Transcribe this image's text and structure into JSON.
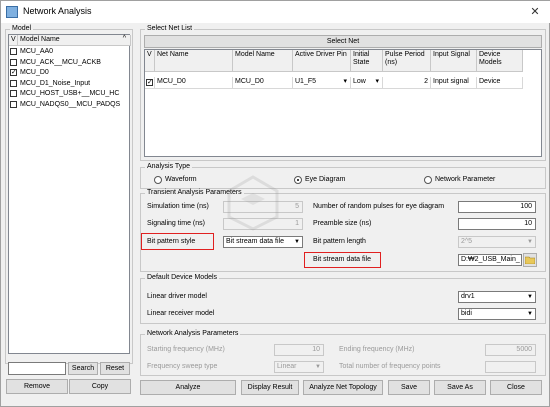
{
  "window": {
    "title": "Network Analysis",
    "close_glyph": "✕"
  },
  "model_panel": {
    "group_label": "Model",
    "header_v": "V",
    "header_name": "Model Name",
    "items": [
      {
        "checked": false,
        "name": "MCU_AA0"
      },
      {
        "checked": false,
        "name": "MCU_ACK__MCU_ACKB"
      },
      {
        "checked": true,
        "name": "MCU_D0"
      },
      {
        "checked": false,
        "name": "MCU_D1_Noise_Input"
      },
      {
        "checked": false,
        "name": "MCU_HOST_USB+__MCU_HC"
      },
      {
        "checked": false,
        "name": "MCU_NADQS0__MCU_PADQS"
      }
    ],
    "search_value": "",
    "search_label": "Search",
    "reset_label": "Reset",
    "remove_label": "Remove",
    "copy_label": "Copy"
  },
  "net_list": {
    "group_label": "Select Net List",
    "select_net_label": "Select Net",
    "headers": [
      "V",
      "Net Name",
      "Model Name",
      "Active Driver Pin",
      "Initial State",
      "Pulse Period (ns)",
      "Input Signal",
      "Device Models"
    ],
    "rows": [
      {
        "checked": true,
        "net_name": "MCU_D0",
        "model_name": "MCU_D0",
        "driver_pin": "U1_F5",
        "initial_state": "Low",
        "pulse_period": "2",
        "input_signal": "Input signal",
        "device_models": "Device"
      }
    ]
  },
  "analysis_type": {
    "group_label": "Analysis Type",
    "options": [
      "Waveform",
      "Eye Diagram",
      "Network Parameter"
    ],
    "selected": "Eye Diagram"
  },
  "transient": {
    "group_label": "Transient Analysis Parameters",
    "simulation_time_label": "Simulation time (ns)",
    "simulation_time_value": "5",
    "signaling_time_label": "Signaling time (ns)",
    "signaling_time_value": "1",
    "random_pulses_label": "Number of random pulses for eye diagram",
    "random_pulses_value": "100",
    "preamble_label": "Preamble size (ns)",
    "preamble_value": "10",
    "bit_pattern_label": "Bit pattern style",
    "bit_pattern_value": "Bit stream data file",
    "bit_length_label": "Bit pattern length",
    "bit_length_value": "2^5",
    "bit_stream_label": "Bit stream data file",
    "bit_stream_value": "D:₩2_USB_Main_"
  },
  "device_models": {
    "group_label": "Default Device Models",
    "driver_label": "Linear driver model",
    "driver_value": "drv1",
    "receiver_label": "Linear receiver model",
    "receiver_value": "bidi"
  },
  "network_params": {
    "group_label": "Network Analysis Parameters",
    "start_label": "Starting frequency (MHz)",
    "start_value": "10",
    "end_label": "Ending frequency (MHz)",
    "end_value": "5000",
    "sweep_label": "Frequency sweep type",
    "sweep_value": "Linear",
    "points_label": "Total number of frequency points",
    "points_value": ""
  },
  "footer": {
    "analyze": "Analyze",
    "display_result": "Display Result",
    "analyze_net_topology": "Analyze Net Topology",
    "save": "Save",
    "save_as": "Save As",
    "close": "Close"
  },
  "colors": {
    "highlight": "#e02020",
    "background": "#f0f0f0"
  },
  "icons": {
    "folder": "folder-icon",
    "app": "app-icon",
    "close": "close-icon",
    "sort": "sort-indicator-icon"
  }
}
